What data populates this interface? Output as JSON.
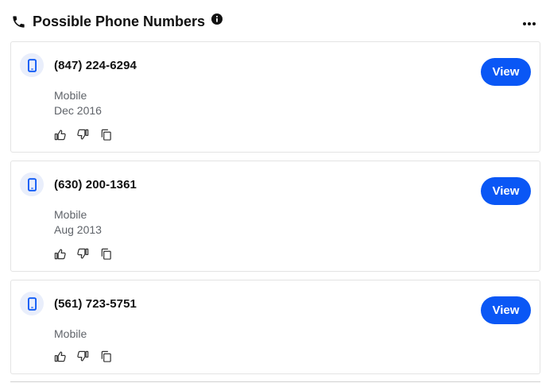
{
  "header": {
    "title": "Possible Phone Numbers",
    "icons": [
      "phone-icon",
      "info-icon",
      "more-options-icon"
    ]
  },
  "phones": [
    {
      "number": "(847) 224-6294",
      "type": "Mobile",
      "date": "Dec 2016",
      "view_label": "View"
    },
    {
      "number": "(630) 200-1361",
      "type": "Mobile",
      "date": "Aug 2013",
      "view_label": "View"
    },
    {
      "number": "(561) 723-5751",
      "type": "Mobile",
      "date": "",
      "view_label": "View"
    }
  ],
  "colors": {
    "accent": "#0a57f5",
    "badge_bg": "#e9eefb",
    "muted_text": "#5f6369",
    "border": "#e3e3e3"
  }
}
